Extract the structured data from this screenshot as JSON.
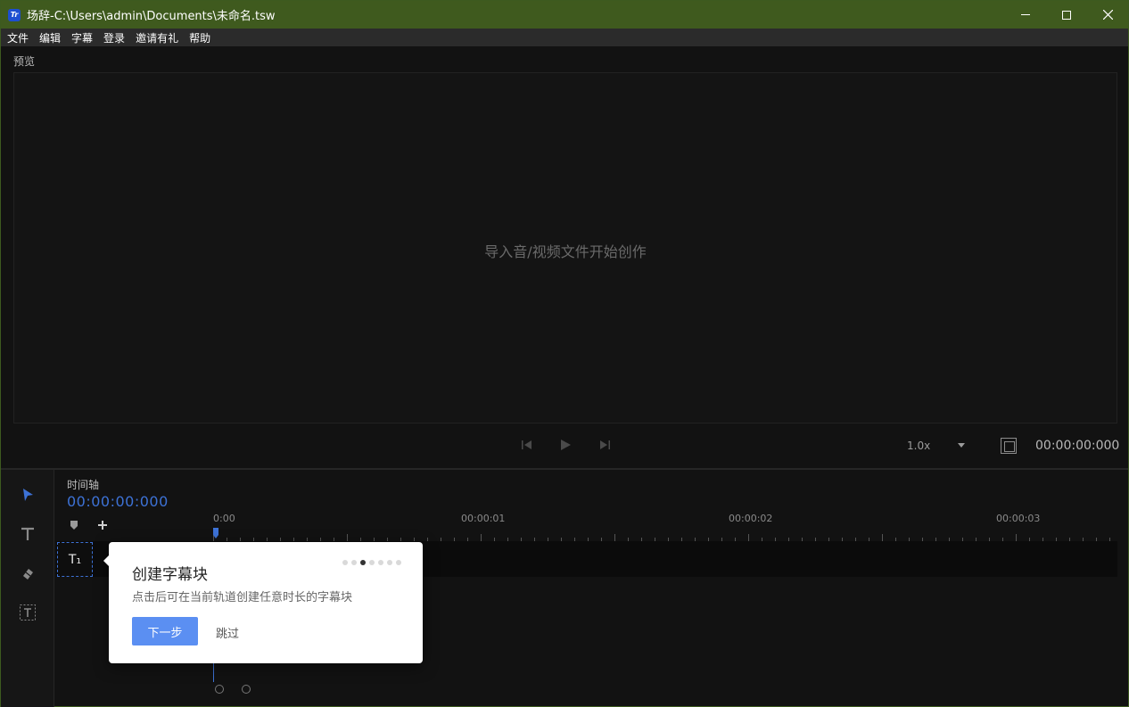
{
  "window": {
    "title": "场辞-C:\\Users\\admin\\Documents\\未命名.tsw",
    "app_icon_text": "Tr",
    "accent": "#3f5a1e"
  },
  "menu": [
    "文件",
    "编辑",
    "字幕",
    "登录",
    "邀请有礼",
    "帮助"
  ],
  "preview": {
    "label": "预览",
    "hint": "导入音/视频文件开始创作",
    "speed": "1.0x",
    "timecode": "00:00:00:000"
  },
  "timeline": {
    "label": "时间轴",
    "timecode": "00:00:00:000",
    "ruler_labels": [
      "0:00",
      "00:00:01",
      "00:00:02",
      "00:00:03"
    ],
    "track_icon_text": "T₁",
    "accent": "#3d72d6"
  },
  "guide": {
    "title": "创建字幕块",
    "description": "点击后可在当前轨道创建任意时长的字幕块",
    "step": 3,
    "total_steps": 7,
    "next_label": "下一步",
    "skip_label": "跳过",
    "button_color": "#5b8ff2"
  }
}
